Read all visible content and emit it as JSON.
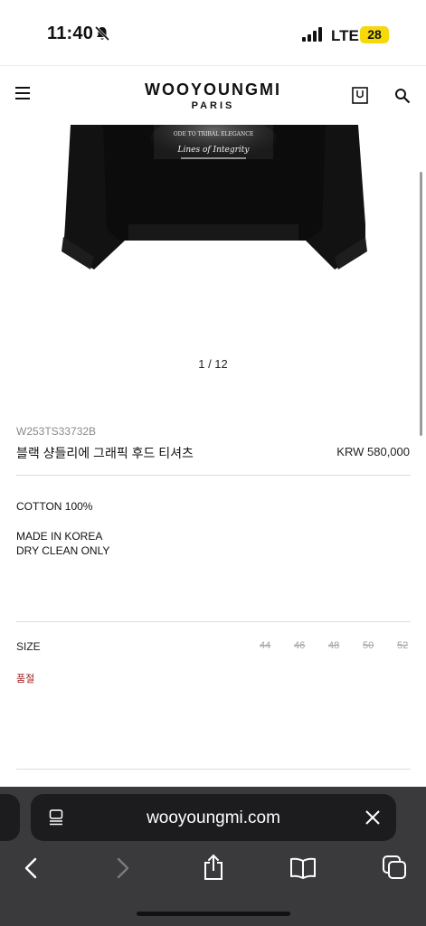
{
  "status_bar": {
    "time": "11:40",
    "network": "LTE",
    "battery": "28"
  },
  "header": {
    "logo_main": "WOOYOUNGMI",
    "logo_sub": "PARIS"
  },
  "gallery": {
    "counter": "1 / 12",
    "graphic_lines": [
      "ODE TO TRIBAL ELEGANCE",
      "Lines of Integrity"
    ]
  },
  "product": {
    "code": "W253TS33732B",
    "name": "블랙 샹들리에 그래픽 후드 티셔츠",
    "price": "KRW 580,000",
    "composition": "COTTON 100%",
    "origin": "MADE IN KOREA",
    "care": "DRY CLEAN ONLY"
  },
  "size": {
    "label": "SIZE",
    "options": [
      "44",
      "46",
      "48",
      "50",
      "52"
    ],
    "status": "품절"
  },
  "browser": {
    "url": "wooyoungmi.com"
  },
  "colors": {
    "soldout": "#a11f1f",
    "battery": "#f5d90a",
    "browser_bar": "#3a3a3c"
  }
}
